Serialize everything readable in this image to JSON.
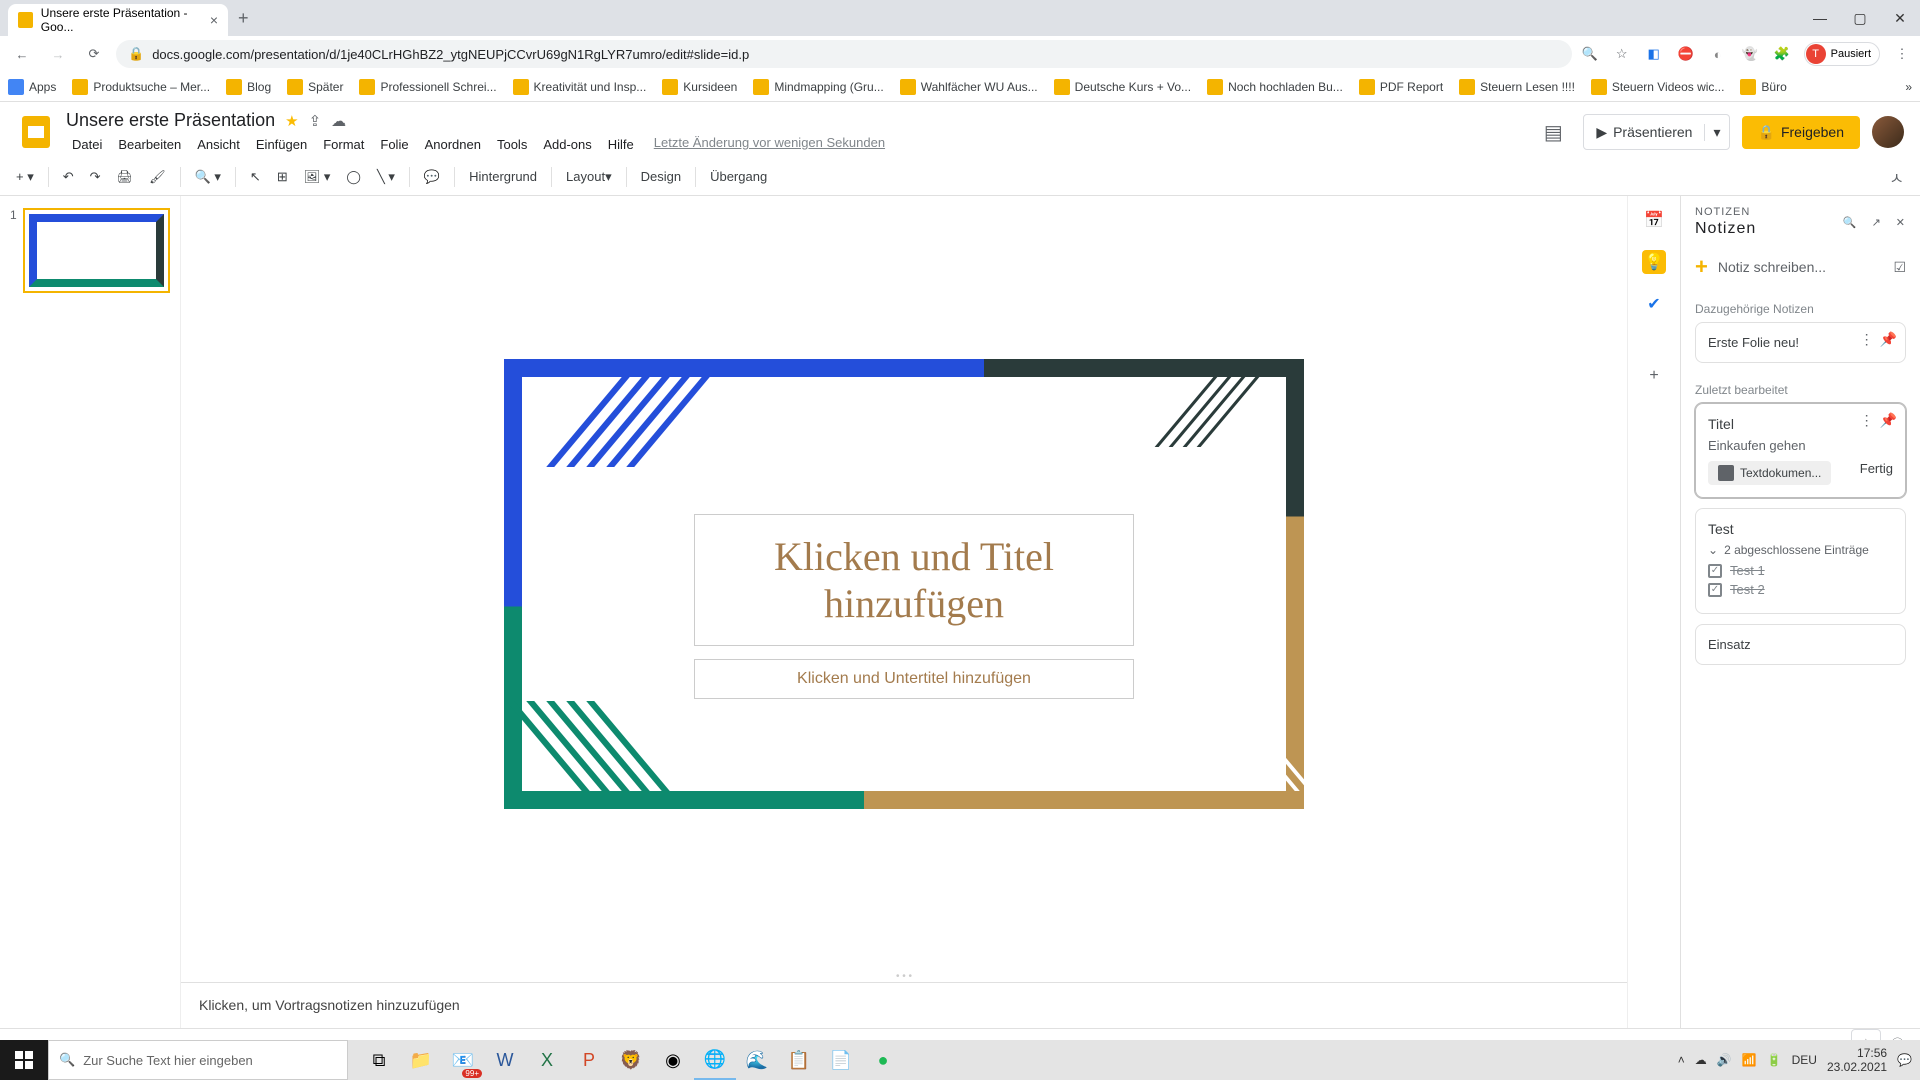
{
  "browser": {
    "tab_title": "Unsere erste Präsentation - Goo...",
    "url": "docs.google.com/presentation/d/1je40CLrHGhBZ2_ytgNEUPjCCvrU69gN1RgLYR7umro/edit#slide=id.p",
    "pause_label": "Pausiert",
    "avatar_letter": "T"
  },
  "bookmarks": {
    "apps": "Apps",
    "items": [
      "Produktsuche – Mer...",
      "Blog",
      "Später",
      "Professionell Schrei...",
      "Kreativität und Insp...",
      "Kursideen",
      "Mindmapping  (Gru...",
      "Wahlfächer WU Aus...",
      "Deutsche Kurs + Vo...",
      "Noch hochladen Bu...",
      "PDF Report",
      "Steuern Lesen !!!!",
      "Steuern Videos wic...",
      "Büro"
    ]
  },
  "app": {
    "doc_title": "Unsere erste Präsentation",
    "menu": [
      "Datei",
      "Bearbeiten",
      "Ansicht",
      "Einfügen",
      "Format",
      "Folie",
      "Anordnen",
      "Tools",
      "Add-ons",
      "Hilfe"
    ],
    "edit_info": "Letzte Änderung vor wenigen Sekunden",
    "present": "Präsentieren",
    "share": "Freigeben"
  },
  "toolbar": {
    "background": "Hintergrund",
    "layout": "Layout",
    "design": "Design",
    "transition": "Übergang"
  },
  "slide": {
    "number": "1",
    "title_placeholder": "Klicken und Titel hinzufügen",
    "subtitle_placeholder": "Klicken und Untertitel hinzufügen",
    "speaker_notes": "Klicken, um Vortragsnotizen hinzuzufügen"
  },
  "keep": {
    "header_small": "NOTIZEN",
    "header": "Notizen",
    "new_note": "Notiz schreiben...",
    "related_label": "Dazugehörige Notizen",
    "recent_label": "Zuletzt bearbeitet",
    "note_related": "Erste Folie neu!",
    "cards": [
      {
        "title": "Titel",
        "body": "Einkaufen gehen",
        "chip": "Textdokumen...",
        "done": "Fertig"
      },
      {
        "title": "Test",
        "toggle": "2 abgeschlossene Einträge",
        "items": [
          "Test 1",
          "Test 2"
        ]
      },
      {
        "title": "Einsatz"
      }
    ]
  },
  "taskbar": {
    "search_placeholder": "Zur Suche Text hier eingeben",
    "badge": "99+",
    "lang": "DEU",
    "time": "17:56",
    "date": "23.02.2021"
  }
}
